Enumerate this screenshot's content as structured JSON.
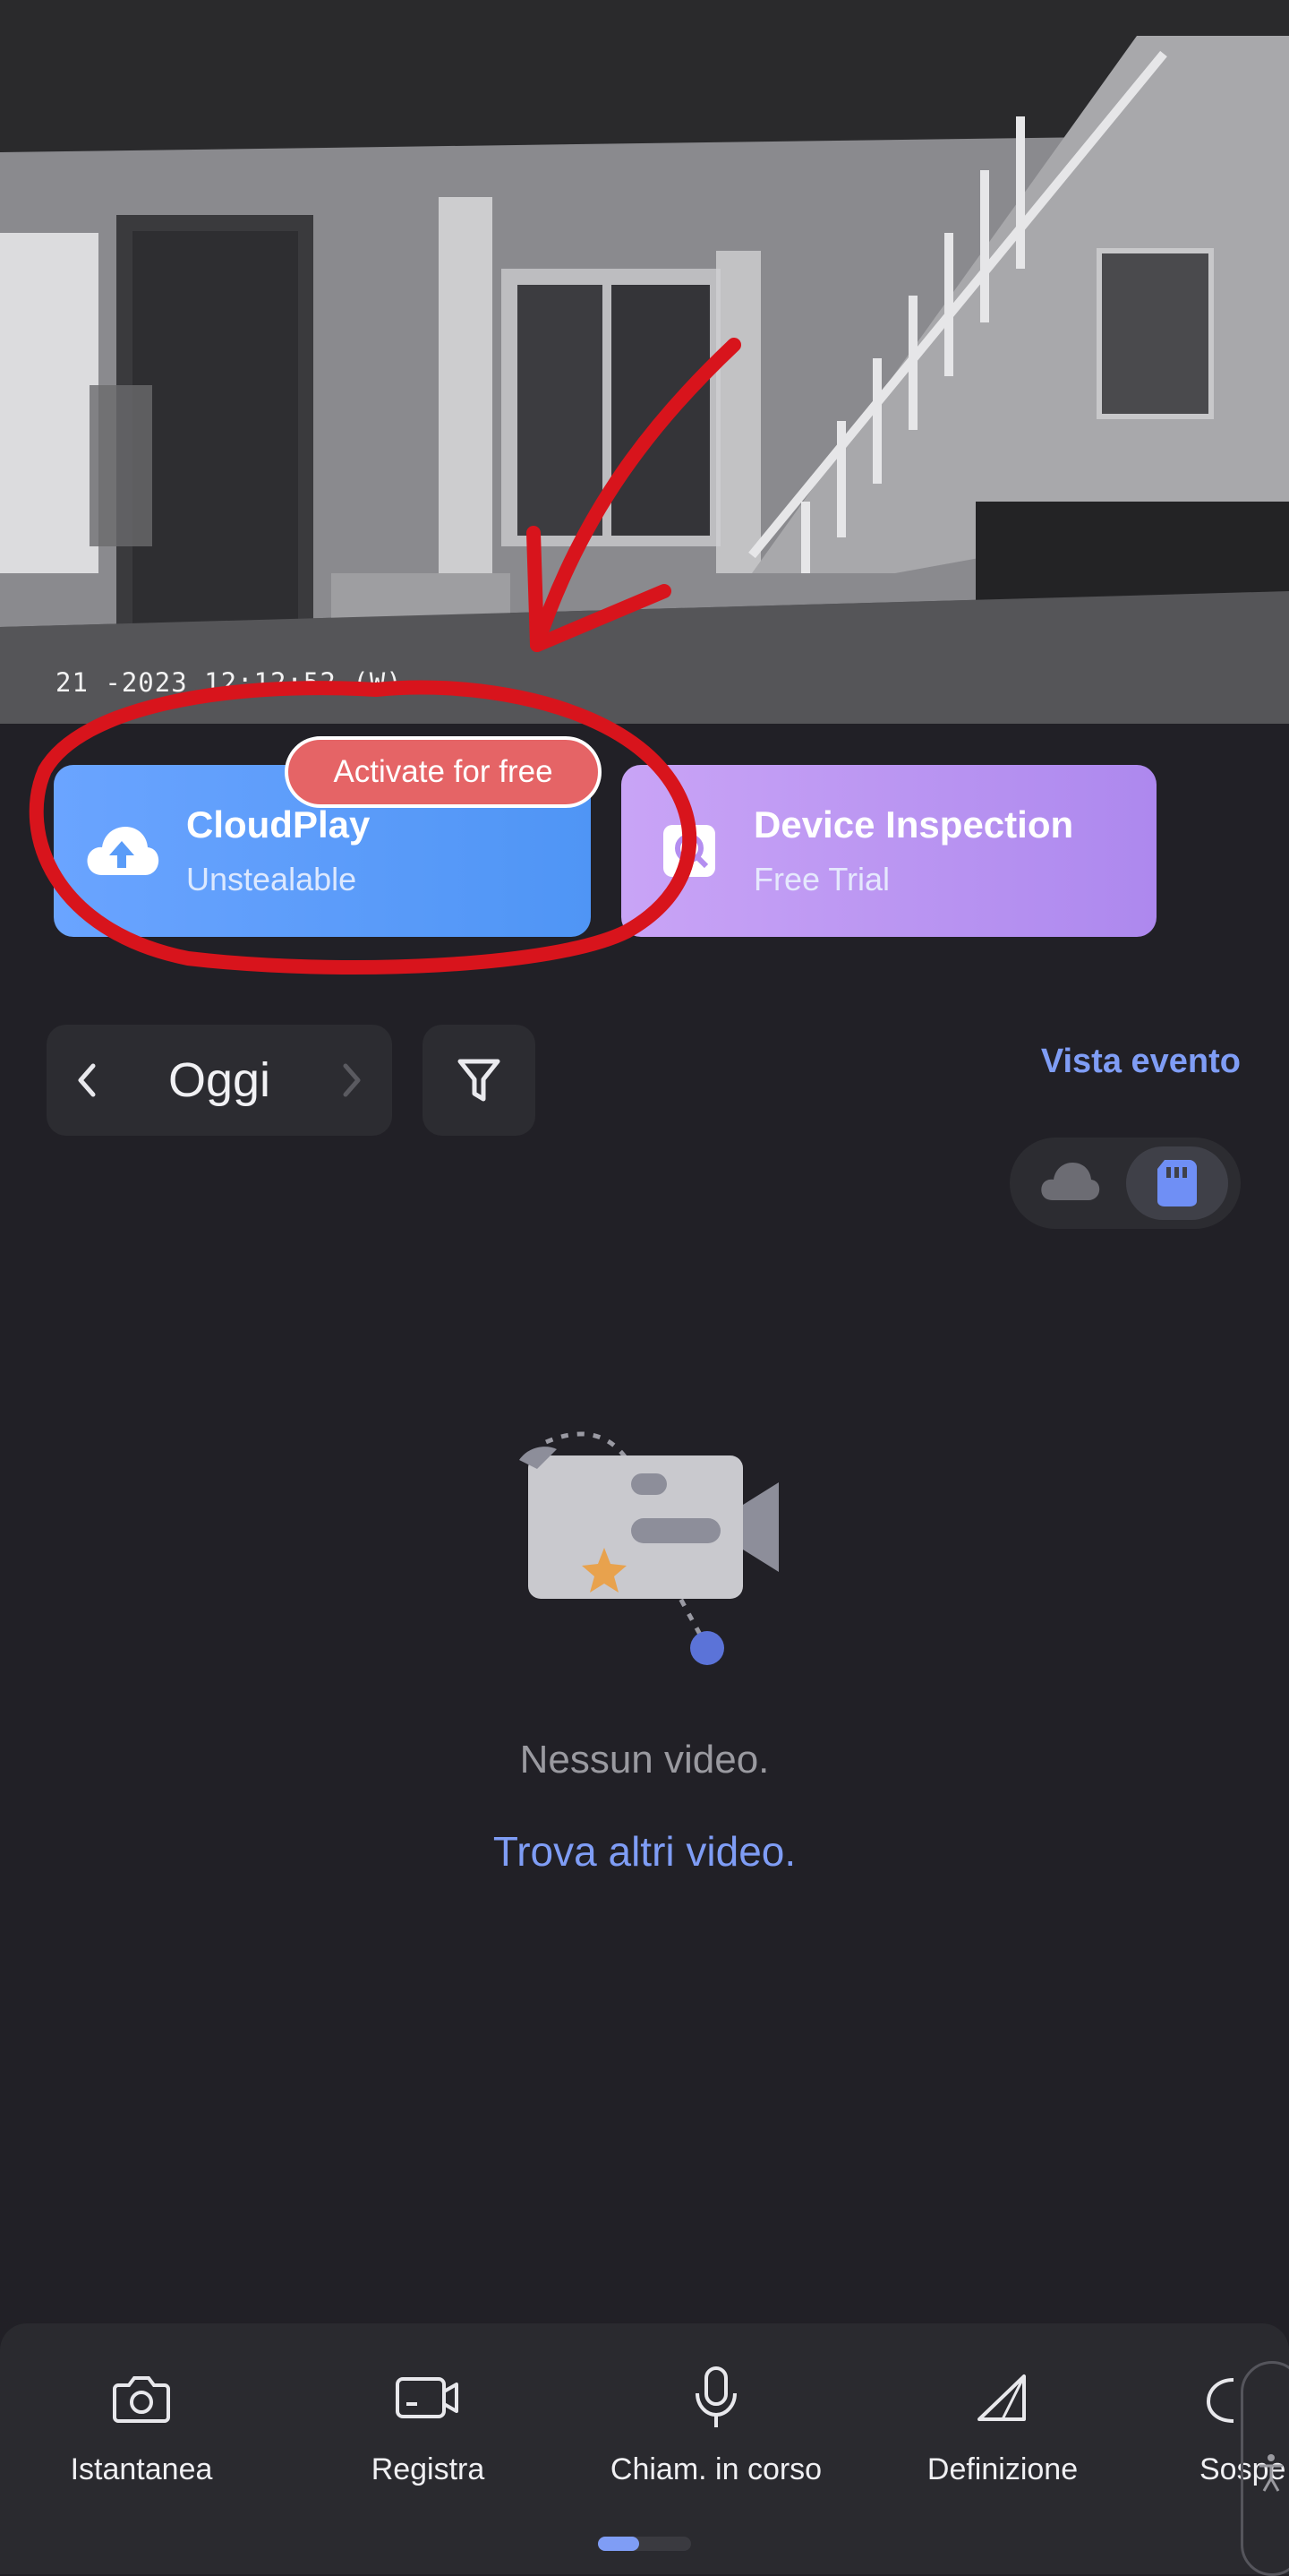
{
  "camera": {
    "timestamp": "21 -2023 12:12:52  (W)"
  },
  "promos": {
    "cloud": {
      "title": "CloudPlay",
      "subtitle": "Unstealable",
      "badge": "Activate for free",
      "icon": "cloud-upload-icon"
    },
    "device": {
      "title": "Device Inspection",
      "subtitle": "Free Trial",
      "icon": "inspection-icon"
    }
  },
  "date_nav": {
    "label": "Oggi"
  },
  "event_view_label": "Vista evento",
  "storage_toggle": {
    "options": [
      "cloud",
      "sd-card"
    ],
    "selected": "sd-card"
  },
  "empty_state": {
    "message": "Nessun video.",
    "link": "Trova altri video."
  },
  "toolbar": {
    "items": [
      {
        "label": "Istantanea",
        "icon": "camera-icon"
      },
      {
        "label": "Registra",
        "icon": "video-record-icon"
      },
      {
        "label": "Chiam. in corso",
        "icon": "microphone-icon"
      },
      {
        "label": "Definizione",
        "icon": "definition-icon"
      },
      {
        "label": "Sospe",
        "icon": "sleep-icon"
      }
    ]
  },
  "colors": {
    "accent": "#7f9df5",
    "cloud_card": "#5a9cf8",
    "device_card": "#bb96f2",
    "badge": "#e56466",
    "annotation": "#d8141c"
  }
}
